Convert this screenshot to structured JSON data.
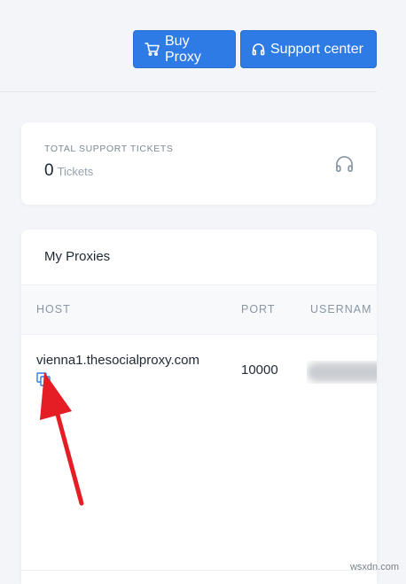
{
  "header": {
    "buy_label": "Buy Proxy",
    "support_label": "Support center"
  },
  "stats": {
    "label": "TOTAL SUPPORT TICKETS",
    "value": "0",
    "unit": "Tickets",
    "icon": "headphones-icon"
  },
  "proxies": {
    "title": "My Proxies",
    "columns": [
      "HOST",
      "PORT",
      "USERNAM"
    ],
    "rows": [
      {
        "host": "vienna1.thesocialproxy.com",
        "port": "10000",
        "username": ""
      }
    ]
  },
  "watermark": "wsxdn.com",
  "colors": {
    "accent": "#2f7be5",
    "annotation_arrow": "#e51e25"
  }
}
